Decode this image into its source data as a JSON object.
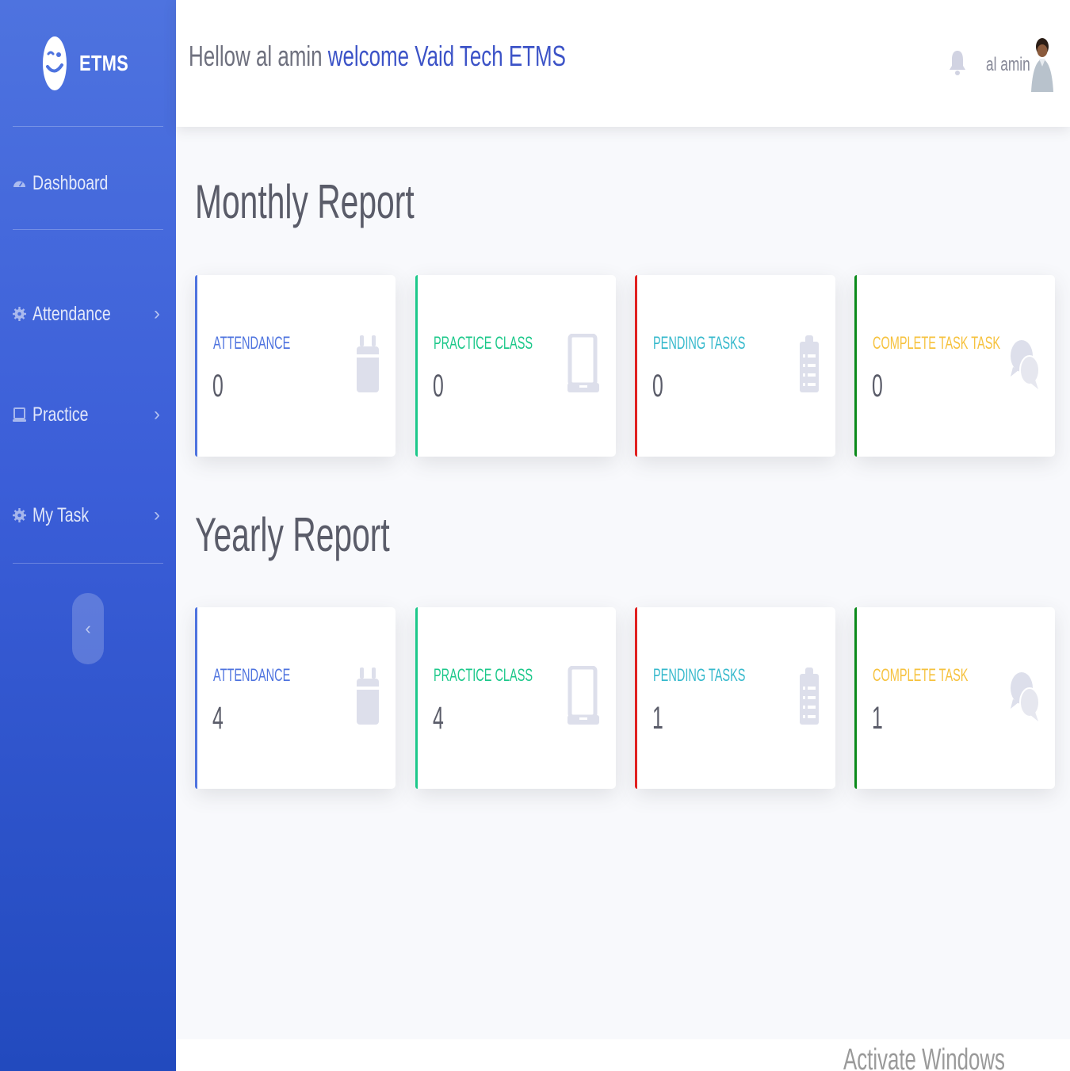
{
  "colors": {
    "sidebar_top": "#4e73df",
    "sidebar_bottom": "#224abe",
    "primary": "#4e73df",
    "success": "#1cc88a",
    "danger": "#e02020",
    "green": "#0a8a1a",
    "info": "#36b9cc",
    "warning": "#f6c23e",
    "greeting_accent": "#3c53c7"
  },
  "brand": {
    "name": "ETMS",
    "icon": "wink-face-icon"
  },
  "sidebar": {
    "items": [
      {
        "label": "Dashboard",
        "icon": "dashboard-icon",
        "has_chevron": false
      },
      {
        "label": "Attendance",
        "icon": "gear-icon",
        "has_chevron": true
      },
      {
        "label": "Practice",
        "icon": "laptop-icon",
        "has_chevron": true
      },
      {
        "label": "My Task",
        "icon": "gear-icon",
        "has_chevron": true
      }
    ],
    "chevron": "›",
    "toggle": "‹"
  },
  "topbar": {
    "greeting_prefix": "Hellow al amin",
    "greeting_suffix": "welcome Vaid Tech ETMS",
    "bell_icon": "bell-icon",
    "username": "al amin",
    "avatar_icon": "user-avatar"
  },
  "monthly": {
    "title": "Monthly Report",
    "cards": [
      {
        "label": "ATTENDANCE",
        "value": "0",
        "color": "#4e73df",
        "edge": "#4e73df",
        "icon": "calendar-icon"
      },
      {
        "label": "PRACTICE CLASS",
        "value": "0",
        "color": "#1cc88a",
        "edge": "#1cc88a",
        "icon": "laptop-icon"
      },
      {
        "label": "PENDING TASKS",
        "value": "0",
        "color": "#36b9cc",
        "edge": "#e02020",
        "icon": "clipboard-list-icon"
      },
      {
        "label": "COMPLETE TASK TASK",
        "value": "0",
        "color": "#f6c23e",
        "edge": "#0a8a1a",
        "icon": "comments-icon"
      }
    ]
  },
  "yearly": {
    "title": "Yearly Report",
    "cards": [
      {
        "label": "ATTENDANCE",
        "value": "4",
        "color": "#4e73df",
        "edge": "#4e73df",
        "icon": "calendar-icon"
      },
      {
        "label": "PRACTICE CLASS",
        "value": "4",
        "color": "#1cc88a",
        "edge": "#1cc88a",
        "icon": "laptop-icon"
      },
      {
        "label": "PENDING TASKS",
        "value": "1",
        "color": "#36b9cc",
        "edge": "#e02020",
        "icon": "clipboard-list-icon"
      },
      {
        "label": "COMPLETE TASK",
        "value": "1",
        "color": "#f6c23e",
        "edge": "#0a8a1a",
        "icon": "comments-icon"
      }
    ]
  },
  "watermark": "Activate Windows"
}
